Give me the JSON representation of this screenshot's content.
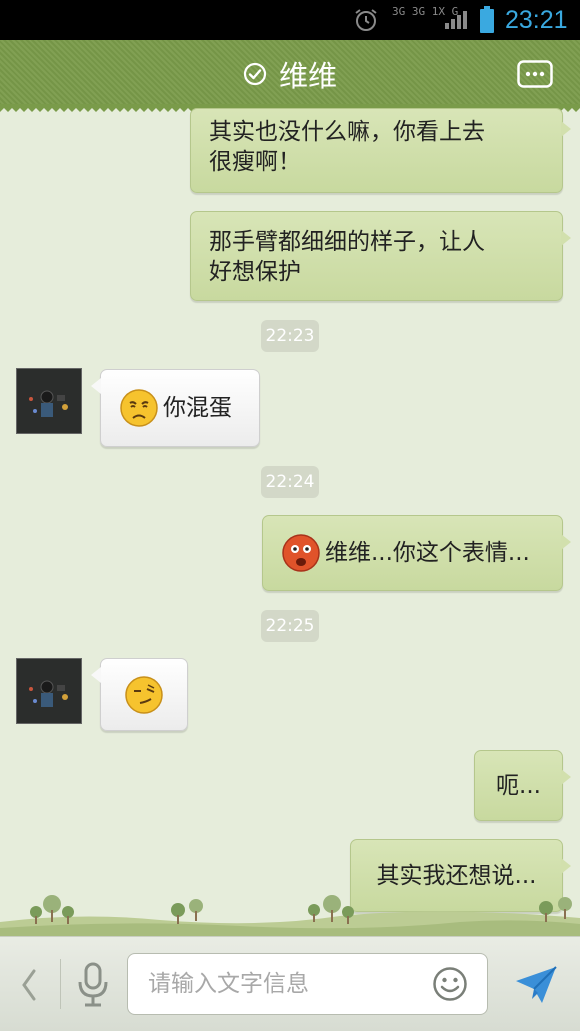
{
  "status_bar": {
    "network_label": "3G 3G 1X G",
    "time": "23:21",
    "icons": [
      "alarm-icon",
      "signal-icon",
      "battery-icon"
    ]
  },
  "header": {
    "title": "维维",
    "status_icon": "check-circle-icon",
    "menu_icon": "chat-menu-icon"
  },
  "messages": [
    {
      "from": "me",
      "type": "text",
      "line1": "其实也没什么嘛，你看上去",
      "line2": "很瘦啊！"
    },
    {
      "from": "me",
      "type": "text",
      "line1": "那手臂都细细的样子，让人",
      "line2": "好想保护"
    },
    {
      "type": "timestamp",
      "text": "22:23"
    },
    {
      "from": "them",
      "type": "emoji_text",
      "emoji": "sad-face-emoji",
      "text": "你混蛋"
    },
    {
      "type": "timestamp",
      "text": "22:24"
    },
    {
      "from": "me",
      "type": "emoji_text",
      "emoji": "shocked-face-emoji",
      "text": "维维...你这个表情..."
    },
    {
      "type": "timestamp",
      "text": "22:25"
    },
    {
      "from": "them",
      "type": "emoji",
      "emoji": "smirk-face-emoji"
    },
    {
      "from": "me",
      "type": "text",
      "text": "呃..."
    },
    {
      "from": "me",
      "type": "text",
      "text": "其实我还想说..."
    }
  ],
  "input_bar": {
    "placeholder": "请输入文字信息",
    "value": ""
  },
  "colors": {
    "header_green": "#7a9b4a",
    "chat_bg": "#e6eddb",
    "outgoing_bubble": "#d2e0ad",
    "incoming_bubble": "#f8f8f8",
    "time_blue": "#3aa9e0",
    "send_blue": "#3a8fd8"
  }
}
